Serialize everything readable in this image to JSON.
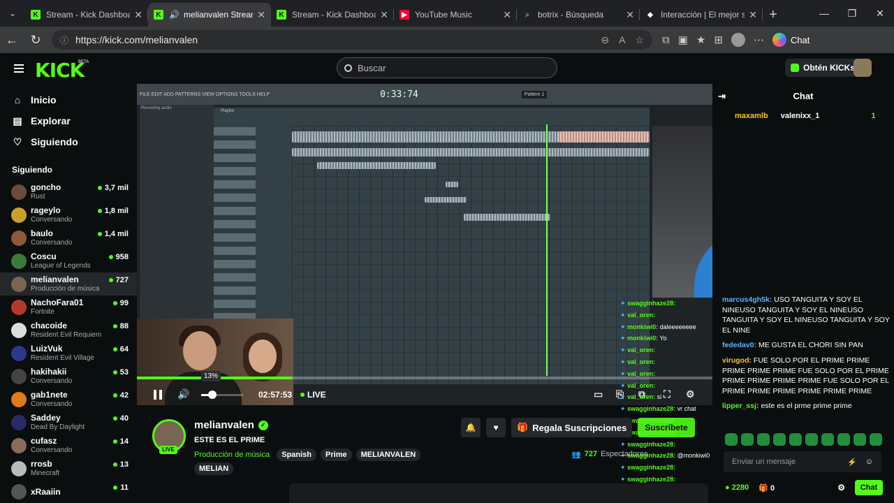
{
  "browser": {
    "tabs": [
      {
        "title": "Stream - Kick Dashboard",
        "icon": "kick-icon",
        "active": false
      },
      {
        "title": "melianvalen Stream",
        "icon": "kick-icon",
        "active": true
      },
      {
        "title": "Stream - Kick Dashboard",
        "icon": "kick-icon",
        "active": false
      },
      {
        "title": "YouTube Music",
        "icon": "youtube-music-icon",
        "active": false
      },
      {
        "title": "botrix - Búsqueda",
        "icon": "search-icon",
        "active": false
      },
      {
        "title": "Interacción | El mejor so",
        "icon": "site-icon",
        "active": false
      }
    ],
    "url": "https://kick.com/melianvalen",
    "chat_label": "Chat"
  },
  "kick": {
    "logo": "KICK",
    "beta": "BETA",
    "search_placeholder": "Buscar",
    "get_kicks": "Obtén KICKs",
    "nav": [
      {
        "label": "Inicio",
        "icon": "home-icon"
      },
      {
        "label": "Explorar",
        "icon": "explore-icon"
      },
      {
        "label": "Siguiendo",
        "icon": "heart-icon"
      }
    ],
    "following_title": "Siguiendo",
    "following": [
      {
        "name": "goncho",
        "game": "Rust",
        "viewers": "3,7 mil",
        "color": "#6b4c3b"
      },
      {
        "name": "rageylo",
        "game": "Conversando",
        "viewers": "1,8 mil",
        "color": "#c7a12a"
      },
      {
        "name": "baulo",
        "game": "Conversando",
        "viewers": "1,4 mil",
        "color": "#8a5a3a"
      },
      {
        "name": "Coscu",
        "game": "League of Legends",
        "viewers": "958",
        "color": "#3a7a3a"
      },
      {
        "name": "melianvalen",
        "game": "Producción de música",
        "viewers": "727",
        "color": "#7a6452"
      },
      {
        "name": "NachoFara01",
        "game": "Fortnite",
        "viewers": "99",
        "color": "#b33a2a"
      },
      {
        "name": "chacoide",
        "game": "Resident Evil Requiem",
        "viewers": "88",
        "color": "#ddd"
      },
      {
        "name": "LuizVuk",
        "game": "Resident Evil Village",
        "viewers": "64",
        "color": "#2a3a8a"
      },
      {
        "name": "hakihakii",
        "game": "Conversando",
        "viewers": "53",
        "color": "#444"
      },
      {
        "name": "gab1nete",
        "game": "Conversando",
        "viewers": "42",
        "color": "#e07a1a"
      },
      {
        "name": "Saddey",
        "game": "Dead By Daylight",
        "viewers": "40",
        "color": "#2a2a6a"
      },
      {
        "name": "cufasz",
        "game": "Conversando",
        "viewers": "14",
        "color": "#8a6a5a"
      },
      {
        "name": "rrosb",
        "game": "Minecraft",
        "viewers": "13",
        "color": "#bbb"
      },
      {
        "name": "xRaaiin",
        "game": "",
        "viewers": "11",
        "color": "#555"
      }
    ]
  },
  "player": {
    "fl_menu": "FILE EDIT ADD PATTERNS VIEW OPTIONS TOOLS HELP",
    "fl_time": "0:33:74",
    "fl_pattern": "Pattern 1",
    "fl_playlist": "Playlist",
    "fl_recording": "Recording audio",
    "volume_tooltip": "13%",
    "volume_level": 0.13,
    "progress": 0.27,
    "time": "02:57:53",
    "live": "LIVE"
  },
  "overlay_chat": [
    {
      "user": "swagginhaze28:",
      "text": ""
    },
    {
      "user": "val_oren:",
      "text": ""
    },
    {
      "user": "monkiwi0:",
      "text": "daleeeeeeee"
    },
    {
      "user": "monkiwi0:",
      "text": "Yo"
    },
    {
      "user": "val_oren:",
      "text": ""
    },
    {
      "user": "val_oren:",
      "text": ""
    },
    {
      "user": "val_oren:",
      "text": ""
    },
    {
      "user": "val_oren:",
      "text": ""
    },
    {
      "user": "val_oren:",
      "text": "si"
    },
    {
      "user": "swagginhaze28:",
      "text": "vr chat"
    },
    {
      "user": "swagginhaze28:",
      "text": ""
    },
    {
      "user": "swagginhaze28:",
      "text": ""
    },
    {
      "user": "swagginhaze28:",
      "text": ""
    },
    {
      "user": "swagginhaze28:",
      "text": "@monkiwi0"
    },
    {
      "user": "swagginhaze28:",
      "text": ""
    },
    {
      "user": "swagginhaze28:",
      "text": ""
    },
    {
      "user": "swagginhaze28:",
      "text": ""
    }
  ],
  "chat": {
    "title": "Chat",
    "pinned": [
      {
        "user": "maxamlb"
      },
      {
        "user": "valenixx_1",
        "count": "1"
      }
    ],
    "messages": [
      {
        "user": "marcus4gh5k:",
        "color": "#5eb3ff",
        "text": "USO TANGUITA Y SOY EL NINEUSO TANGUITA Y SOY EL NINEUSO TANGUITA Y SOY EL NINEUSO TANGUITA Y SOY EL NINE"
      },
      {
        "user": "fededav0:",
        "color": "#5eb3ff",
        "text": "ME GUSTA EL CHORI SIN PAN"
      },
      {
        "user": "virugod:",
        "color": "#f3c62c",
        "text": "FUE SOLO POR EL PRIME PRIME PRIME PRIME PRIME FUE SOLO POR EL PRIME PRIME PRIME PRIME PRIME FUE SOLO POR EL PRIME PRIME PRIME PRIME PRIME PRIME"
      },
      {
        "user": "lipper_ssj:",
        "color": "#53fc18",
        "text": "este es el prme prime prime"
      }
    ],
    "input_placeholder": "Enviar un mensaje",
    "points": "2280",
    "gifts": "0",
    "send_label": "Chat"
  },
  "stream": {
    "name": "melianvalen",
    "live_badge": "LIVE",
    "title": "ESTE ES EL PRIME",
    "category": "Producción de música",
    "tags": [
      "Spanish",
      "Prime",
      "MELIANVALEN"
    ],
    "tags2": "MELIAN",
    "gift_subs": "Regala Suscripciones",
    "subscribe": "Suscríbete",
    "viewers": "727",
    "viewers_label": "Espectadores"
  },
  "colors": {
    "accent": "#53fc18",
    "background": "#0b0e0f"
  }
}
